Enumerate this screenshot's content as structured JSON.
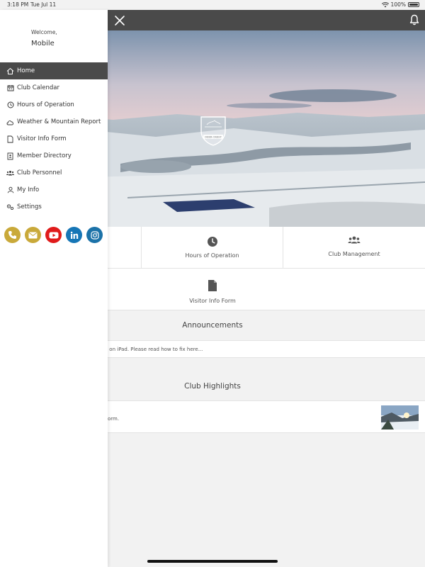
{
  "status": {
    "time": "3:18 PM",
    "date": "Tue Jul 11",
    "battery": "100%"
  },
  "hero": {
    "logo_text": "DEER CREST"
  },
  "tiles": [
    {
      "label": "Club Calendar",
      "visible": "t"
    },
    {
      "label": "Hours of Operation"
    },
    {
      "label": "Club Management"
    },
    {
      "label": "Visitor Info Form"
    }
  ],
  "announcements": {
    "title": "Announcements",
    "item": "ns on iPad. Please read how to fix here..."
  },
  "highlights": {
    "title": "Club Highlights",
    "item": "orm."
  },
  "drawer": {
    "welcome": "Welcome,",
    "username": "Mobile",
    "menu": [
      {
        "label": "Home",
        "icon": "home-icon"
      },
      {
        "label": "Club Calendar",
        "icon": "calendar-icon"
      },
      {
        "label": "Hours of Operation",
        "icon": "clock-icon"
      },
      {
        "label": "Weather & Mountain Report",
        "icon": "cloud-icon"
      },
      {
        "label": "Visitor Info Form",
        "icon": "document-icon"
      },
      {
        "label": "Member Directory",
        "icon": "address-book-icon"
      },
      {
        "label": "Club Personnel",
        "icon": "people-icon"
      },
      {
        "label": "My Info",
        "icon": "user-icon"
      },
      {
        "label": "Settings",
        "icon": "settings-icon"
      }
    ],
    "socials": [
      {
        "name": "phone",
        "color": "#c9a93a"
      },
      {
        "name": "email",
        "color": "#c9a93a"
      },
      {
        "name": "youtube",
        "color": "#e01b1b"
      },
      {
        "name": "linkedin",
        "color": "#1676b6"
      },
      {
        "name": "instagram",
        "color": "#1b72a8"
      }
    ]
  },
  "colors": {
    "topbar": "#4a4a4a",
    "active_menu": "#4a4a4a",
    "background": "#f2f2f2"
  }
}
